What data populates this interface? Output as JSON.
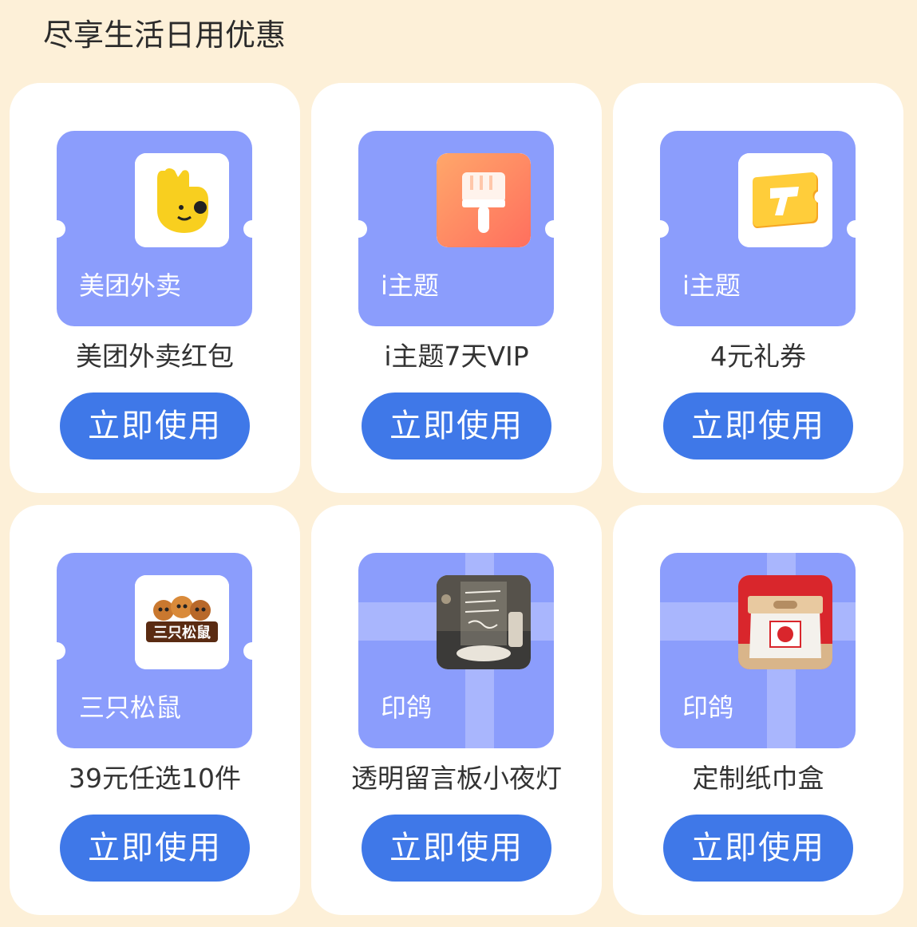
{
  "section": {
    "title": "尽享生活日用优惠"
  },
  "colors": {
    "page_bg": "#fdf0d8",
    "ticket": "#8b9dfc",
    "button": "#3f78e8"
  },
  "cards": [
    {
      "brand": "美团外卖",
      "name": "美团外卖红包",
      "button": "立即使用",
      "icon": "meituan-kangaroo-icon"
    },
    {
      "brand": "i主题",
      "name": "i主题7天VIP",
      "button": "立即使用",
      "icon": "paintbrush-icon"
    },
    {
      "brand": "i主题",
      "name": "4元礼券",
      "button": "立即使用",
      "icon": "coupon-icon"
    },
    {
      "brand": "三只松鼠",
      "name": "39元任选10件",
      "button": "立即使用",
      "icon": "three-squirrels-logo",
      "logo_text": "三只松鼠"
    },
    {
      "brand": "印鸽",
      "name": "透明留言板小夜灯",
      "button": "立即使用",
      "icon": "night-light-photo"
    },
    {
      "brand": "印鸽",
      "name": "定制纸巾盒",
      "button": "立即使用",
      "icon": "tissue-box-photo"
    }
  ]
}
